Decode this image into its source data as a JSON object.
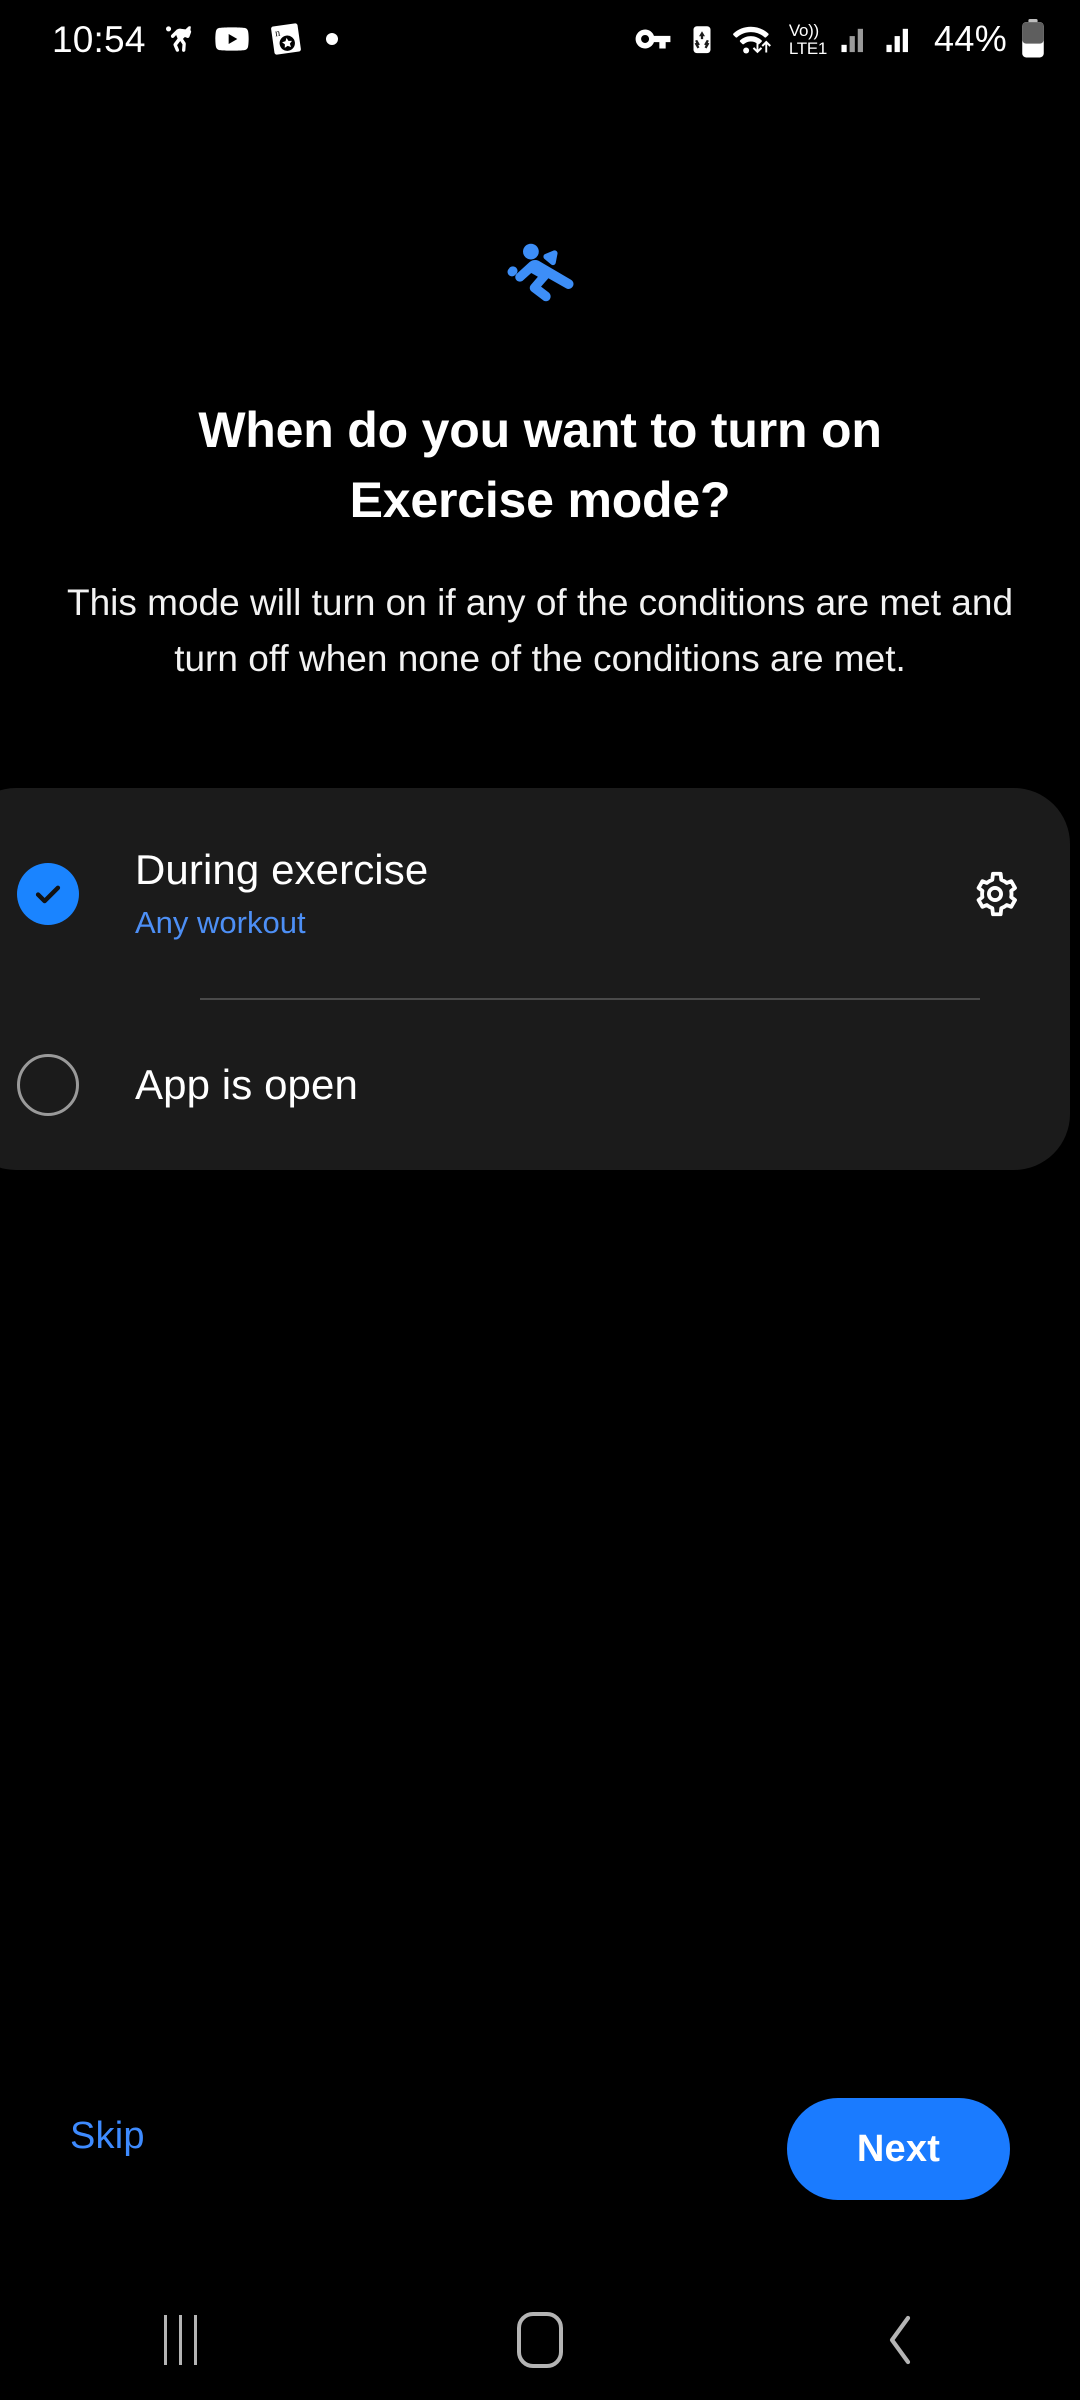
{
  "statusbar": {
    "time": "10:54",
    "left_icons": [
      "horse-icon",
      "youtube-icon",
      "news-app-icon",
      "dot-indicator-icon"
    ],
    "right_icons": [
      "vpn-key-icon",
      "data-saver-icon",
      "wifi-icon",
      "volte-icon",
      "signal-sim1-icon",
      "signal-sim2-icon"
    ],
    "volte_line1": "Vo))",
    "volte_line2": "LTE1",
    "battery_percent": "44%"
  },
  "hero": {
    "icon": "exercise-running-icon",
    "title": "When do you want to turn on Exercise mode?",
    "subtitle": "This mode will turn on if any of the conditions are met and turn off when none of the conditions are met."
  },
  "options": [
    {
      "title": "During exercise",
      "subtitle": "Any workout",
      "selected": true,
      "has_settings": true
    },
    {
      "title": "App is open",
      "subtitle": "",
      "selected": false,
      "has_settings": false
    }
  ],
  "actions": {
    "skip_label": "Skip",
    "next_label": "Next"
  },
  "navbar": {
    "recents": "recents-icon",
    "home": "home-icon",
    "back": "back-icon"
  },
  "colors": {
    "accent_blue": "#1a84ff",
    "link_blue": "#3e8bff",
    "subtitle_blue": "#4d8ff5",
    "card_bg": "#1b1b1b",
    "page_bg": "#000000",
    "button_blue": "#1a7bff"
  }
}
